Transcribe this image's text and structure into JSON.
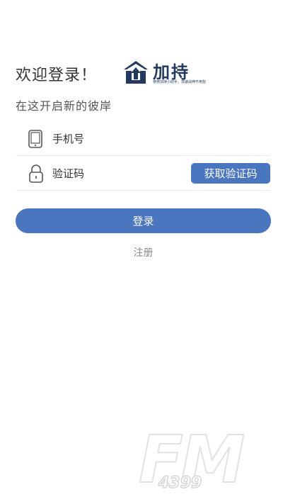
{
  "login": {
    "welcome": "欢迎登录！",
    "subtitle": "在这开启新的彼岸",
    "phone_placeholder": "手机号",
    "code_placeholder": "验证码",
    "get_code_label": "获取验证码",
    "login_label": "登录",
    "register_label": "注册"
  },
  "logo": {
    "text": "加持",
    "slogan": "使用加持小助手，加速战神不用愁",
    "icon": "house-arrow-logo-icon",
    "color": "#233a5e"
  },
  "watermark": {
    "letters": "FM",
    "number": "4399"
  },
  "colors": {
    "accent": "#4a76bf",
    "text": "#333333",
    "muted": "#8a8a8a",
    "divider": "#ececec"
  }
}
